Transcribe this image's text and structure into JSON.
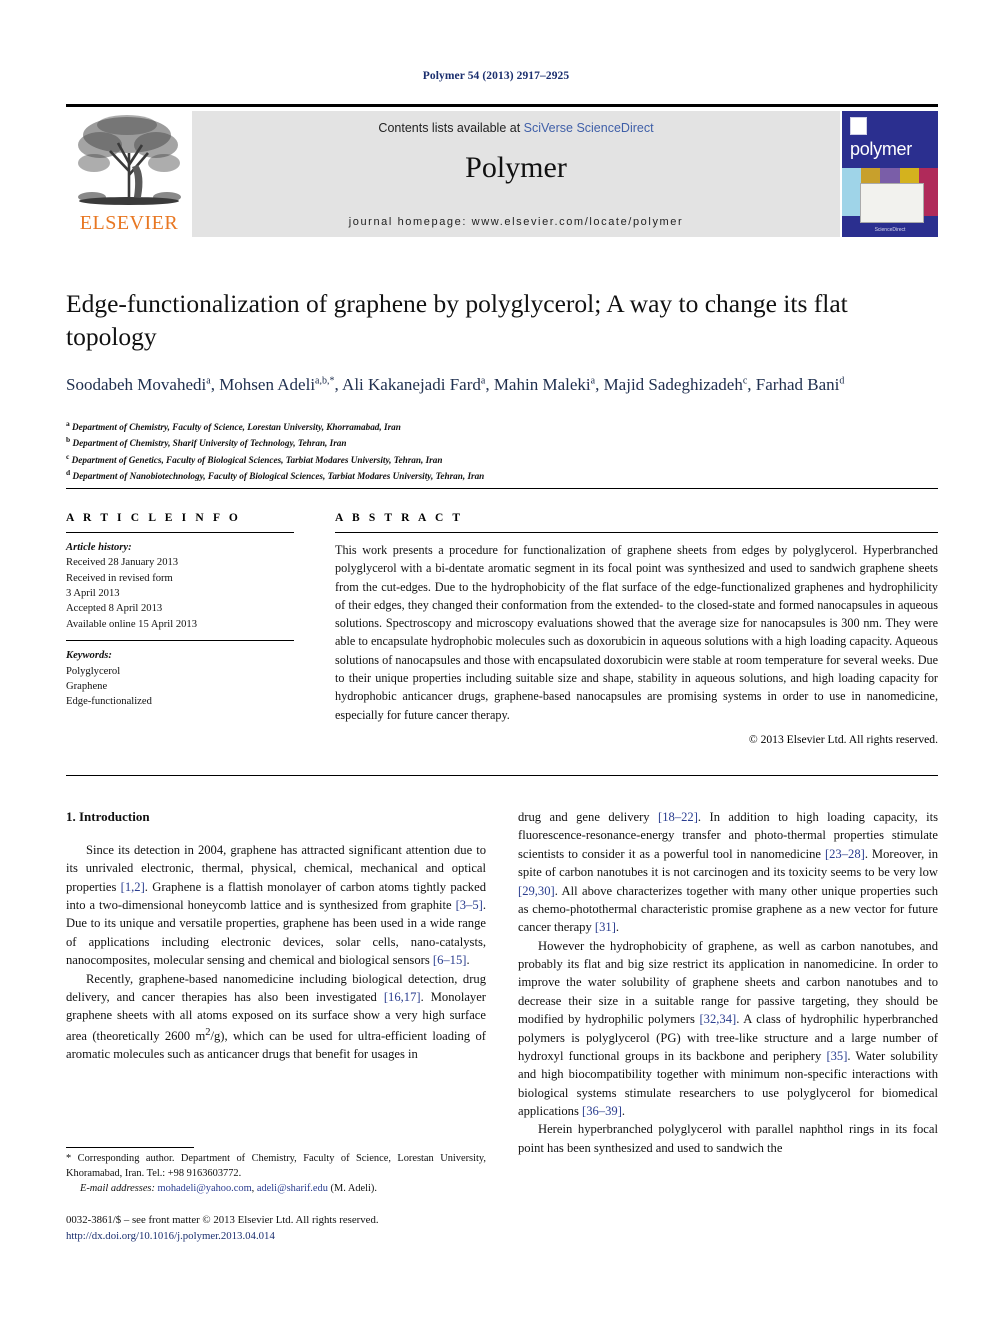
{
  "running_head": "Polymer 54 (2013) 2917–2925",
  "masthead": {
    "publisher": "ELSEVIER",
    "contents_prefix": "Contents lists available at ",
    "contents_link": "SciVerse ScienceDirect",
    "journal_name": "Polymer",
    "homepage": "journal homepage: www.elsevier.com/locate/polymer",
    "cover_title": "polymer",
    "cover_footer": "ScienceDirect"
  },
  "article": {
    "title": "Edge-functionalization of graphene by polyglycerol; A way to change its flat topology",
    "authors_html": "Soodabeh Movahedi<sup>a</sup>, Mohsen Adeli<sup>a,b,</sup><sup>*</sup>, Ali Kakanejadi Fard<sup>a</sup>, Mahin Maleki<sup>a</sup>, Majid Sadeghizadeh<sup>c</sup>, Farhad Bani<sup>d</sup>",
    "affiliations": [
      {
        "label": "a",
        "text": "Department of Chemistry, Faculty of Science, Lorestan University, Khorramabad, Iran"
      },
      {
        "label": "b",
        "text": "Department of Chemistry, Sharif University of Technology, Tehran, Iran"
      },
      {
        "label": "c",
        "text": "Department of Genetics, Faculty of Biological Sciences, Tarbiat Modares University, Tehran, Iran"
      },
      {
        "label": "d",
        "text": "Department of Nanobiotechnology, Faculty of Biological Sciences, Tarbiat Modares University, Tehran, Iran"
      }
    ]
  },
  "info": {
    "heading": "A R T I C L E   I N F O",
    "history_label": "Article history:",
    "history": [
      "Received 28 January 2013",
      "Received in revised form",
      "3 April 2013",
      "Accepted 8 April 2013",
      "Available online 15 April 2013"
    ],
    "keywords_label": "Keywords:",
    "keywords": [
      "Polyglycerol",
      "Graphene",
      "Edge-functionalized"
    ]
  },
  "abstract": {
    "heading": "A B S T R A C T",
    "text": "This work presents a procedure for functionalization of graphene sheets from edges by polyglycerol. Hyperbranched polyglycerol with a bi-dentate aromatic segment in its focal point was synthesized and used to sandwich graphene sheets from the cut-edges. Due to the hydrophobicity of the flat surface of the edge-functionalized graphenes and hydrophilicity of their edges, they changed their conformation from the extended- to the closed-state and formed nanocapsules in aqueous solutions. Spectroscopy and microscopy evaluations showed that the average size for nanocapsules is 300 nm. They were able to encapsulate hydrophobic molecules such as doxorubicin in aqueous solutions with a high loading capacity. Aqueous solutions of nanocapsules and those with encapsulated doxorubicin were stable at room temperature for several weeks. Due to their unique properties including suitable size and shape, stability in aqueous solutions, and high loading capacity for hydrophobic anticancer drugs, graphene-based nanocapsules are promising systems in order to use in nanomedicine, especially for future cancer therapy.",
    "copyright": "© 2013 Elsevier Ltd. All rights reserved."
  },
  "body": {
    "section_number_title": "1. Introduction",
    "left_paragraphs_html": [
      "Since its detection in 2004, graphene has attracted significant attention due to its unrivaled electronic, thermal, physical, chemical, mechanical and optical properties <span class=\"ref\">[1,2]</span>. Graphene is a flattish monolayer of carbon atoms tightly packed into a two-dimensional honeycomb lattice and is synthesized from graphite <span class=\"ref\">[3–5]</span>. Due to its unique and versatile properties, graphene has been used in a wide range of applications including electronic devices, solar cells, nano-catalysts, nanocomposites, molecular sensing and chemical and biological sensors <span class=\"ref\">[6–15]</span>.",
      "Recently, graphene-based nanomedicine including biological detection, drug delivery, and cancer therapies has also been investigated <span class=\"ref\">[16,17]</span>. Monolayer graphene sheets with all atoms exposed on its surface show a very high surface area (theoretically 2600 m<sup>2</sup>/g), which can be used for ultra-efficient loading of aromatic molecules such as anticancer drugs that benefit for usages in"
    ],
    "right_paragraphs_html": [
      "drug and gene delivery <span class=\"ref\">[18–22]</span>. In addition to high loading capacity, its fluorescence-resonance-energy transfer and photo-thermal properties stimulate scientists to consider it as a powerful tool in nanomedicine <span class=\"ref\">[23–28]</span>. Moreover, in spite of carbon nanotubes it is not carcinogen and its toxicity seems to be very low <span class=\"ref\">[29,30]</span>. All above characterizes together with many other unique properties such as chemo-photothermal characteristic promise graphene as a new vector for future cancer therapy <span class=\"ref\">[31]</span>.",
      "However the hydrophobicity of graphene, as well as carbon nanotubes, and probably its flat and big size restrict its application in nanomedicine. In order to improve the water solubility of graphene sheets and carbon nanotubes and to decrease their size in a suitable range for passive targeting, they should be modified by hydrophilic polymers <span class=\"ref\">[32,34]</span>. A class of hydrophilic hyperbranched polymers is polyglycerol (PG) with tree-like structure and a large number of hydroxyl functional groups in its backbone and periphery <span class=\"ref\">[35]</span>. Water solubility and high biocompatibility together with minimum non-specific interactions with biological systems stimulate researchers to use polyglycerol for biomedical applications <span class=\"ref\">[36–39]</span>.",
      "Herein hyperbranched polyglycerol with parallel naphthol rings in its focal point has been synthesized and used to sandwich the"
    ]
  },
  "footnotes": {
    "corresponding_html": "* Corresponding author. Department of Chemistry, Faculty of Science, Lorestan University, Khoramabad, Iran. Tel.: +98 9163603772.",
    "email_html": "<span class=\"em\">E-mail addresses:</span> <span class=\"lk\">mohadeli@yahoo.com</span>, <span class=\"lk\">adeli@sharif.edu</span> (M. Adeli)."
  },
  "imprint": {
    "line1": "0032-3861/$ – see front matter © 2013 Elsevier Ltd. All rights reserved.",
    "doi": "http://dx.doi.org/10.1016/j.polymer.2013.04.014"
  },
  "colors": {
    "link_blue": "#2a3d8f",
    "elsevier_orange": "#E87722",
    "cover_blue": "#2b2f8f",
    "band_gray": "#e3e3e3"
  }
}
